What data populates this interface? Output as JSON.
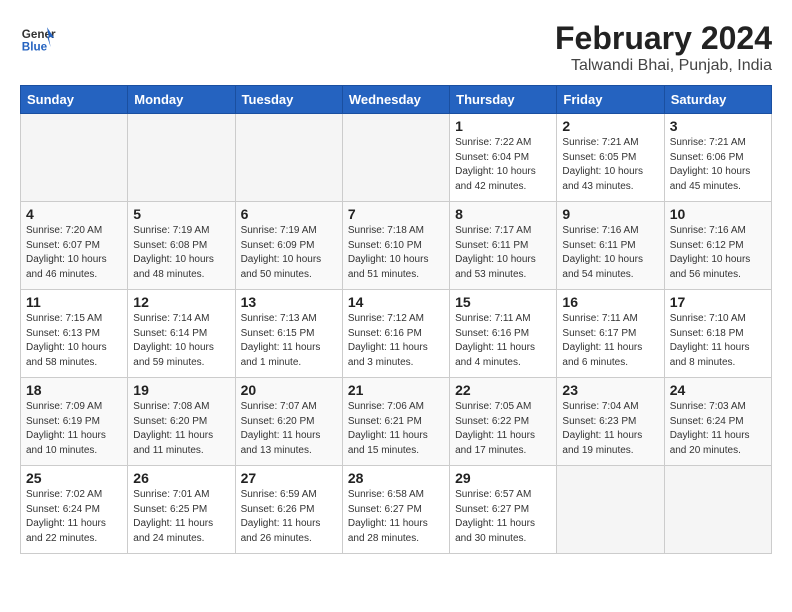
{
  "header": {
    "logo_line1": "General",
    "logo_line2": "Blue",
    "month_year": "February 2024",
    "location": "Talwandi Bhai, Punjab, India"
  },
  "days_of_week": [
    "Sunday",
    "Monday",
    "Tuesday",
    "Wednesday",
    "Thursday",
    "Friday",
    "Saturday"
  ],
  "weeks": [
    [
      {
        "day": "",
        "info": ""
      },
      {
        "day": "",
        "info": ""
      },
      {
        "day": "",
        "info": ""
      },
      {
        "day": "",
        "info": ""
      },
      {
        "day": "1",
        "info": "Sunrise: 7:22 AM\nSunset: 6:04 PM\nDaylight: 10 hours\nand 42 minutes."
      },
      {
        "day": "2",
        "info": "Sunrise: 7:21 AM\nSunset: 6:05 PM\nDaylight: 10 hours\nand 43 minutes."
      },
      {
        "day": "3",
        "info": "Sunrise: 7:21 AM\nSunset: 6:06 PM\nDaylight: 10 hours\nand 45 minutes."
      }
    ],
    [
      {
        "day": "4",
        "info": "Sunrise: 7:20 AM\nSunset: 6:07 PM\nDaylight: 10 hours\nand 46 minutes."
      },
      {
        "day": "5",
        "info": "Sunrise: 7:19 AM\nSunset: 6:08 PM\nDaylight: 10 hours\nand 48 minutes."
      },
      {
        "day": "6",
        "info": "Sunrise: 7:19 AM\nSunset: 6:09 PM\nDaylight: 10 hours\nand 50 minutes."
      },
      {
        "day": "7",
        "info": "Sunrise: 7:18 AM\nSunset: 6:10 PM\nDaylight: 10 hours\nand 51 minutes."
      },
      {
        "day": "8",
        "info": "Sunrise: 7:17 AM\nSunset: 6:11 PM\nDaylight: 10 hours\nand 53 minutes."
      },
      {
        "day": "9",
        "info": "Sunrise: 7:16 AM\nSunset: 6:11 PM\nDaylight: 10 hours\nand 54 minutes."
      },
      {
        "day": "10",
        "info": "Sunrise: 7:16 AM\nSunset: 6:12 PM\nDaylight: 10 hours\nand 56 minutes."
      }
    ],
    [
      {
        "day": "11",
        "info": "Sunrise: 7:15 AM\nSunset: 6:13 PM\nDaylight: 10 hours\nand 58 minutes."
      },
      {
        "day": "12",
        "info": "Sunrise: 7:14 AM\nSunset: 6:14 PM\nDaylight: 10 hours\nand 59 minutes."
      },
      {
        "day": "13",
        "info": "Sunrise: 7:13 AM\nSunset: 6:15 PM\nDaylight: 11 hours\nand 1 minute."
      },
      {
        "day": "14",
        "info": "Sunrise: 7:12 AM\nSunset: 6:16 PM\nDaylight: 11 hours\nand 3 minutes."
      },
      {
        "day": "15",
        "info": "Sunrise: 7:11 AM\nSunset: 6:16 PM\nDaylight: 11 hours\nand 4 minutes."
      },
      {
        "day": "16",
        "info": "Sunrise: 7:11 AM\nSunset: 6:17 PM\nDaylight: 11 hours\nand 6 minutes."
      },
      {
        "day": "17",
        "info": "Sunrise: 7:10 AM\nSunset: 6:18 PM\nDaylight: 11 hours\nand 8 minutes."
      }
    ],
    [
      {
        "day": "18",
        "info": "Sunrise: 7:09 AM\nSunset: 6:19 PM\nDaylight: 11 hours\nand 10 minutes."
      },
      {
        "day": "19",
        "info": "Sunrise: 7:08 AM\nSunset: 6:20 PM\nDaylight: 11 hours\nand 11 minutes."
      },
      {
        "day": "20",
        "info": "Sunrise: 7:07 AM\nSunset: 6:20 PM\nDaylight: 11 hours\nand 13 minutes."
      },
      {
        "day": "21",
        "info": "Sunrise: 7:06 AM\nSunset: 6:21 PM\nDaylight: 11 hours\nand 15 minutes."
      },
      {
        "day": "22",
        "info": "Sunrise: 7:05 AM\nSunset: 6:22 PM\nDaylight: 11 hours\nand 17 minutes."
      },
      {
        "day": "23",
        "info": "Sunrise: 7:04 AM\nSunset: 6:23 PM\nDaylight: 11 hours\nand 19 minutes."
      },
      {
        "day": "24",
        "info": "Sunrise: 7:03 AM\nSunset: 6:24 PM\nDaylight: 11 hours\nand 20 minutes."
      }
    ],
    [
      {
        "day": "25",
        "info": "Sunrise: 7:02 AM\nSunset: 6:24 PM\nDaylight: 11 hours\nand 22 minutes."
      },
      {
        "day": "26",
        "info": "Sunrise: 7:01 AM\nSunset: 6:25 PM\nDaylight: 11 hours\nand 24 minutes."
      },
      {
        "day": "27",
        "info": "Sunrise: 6:59 AM\nSunset: 6:26 PM\nDaylight: 11 hours\nand 26 minutes."
      },
      {
        "day": "28",
        "info": "Sunrise: 6:58 AM\nSunset: 6:27 PM\nDaylight: 11 hours\nand 28 minutes."
      },
      {
        "day": "29",
        "info": "Sunrise: 6:57 AM\nSunset: 6:27 PM\nDaylight: 11 hours\nand 30 minutes."
      },
      {
        "day": "",
        "info": ""
      },
      {
        "day": "",
        "info": ""
      }
    ]
  ]
}
